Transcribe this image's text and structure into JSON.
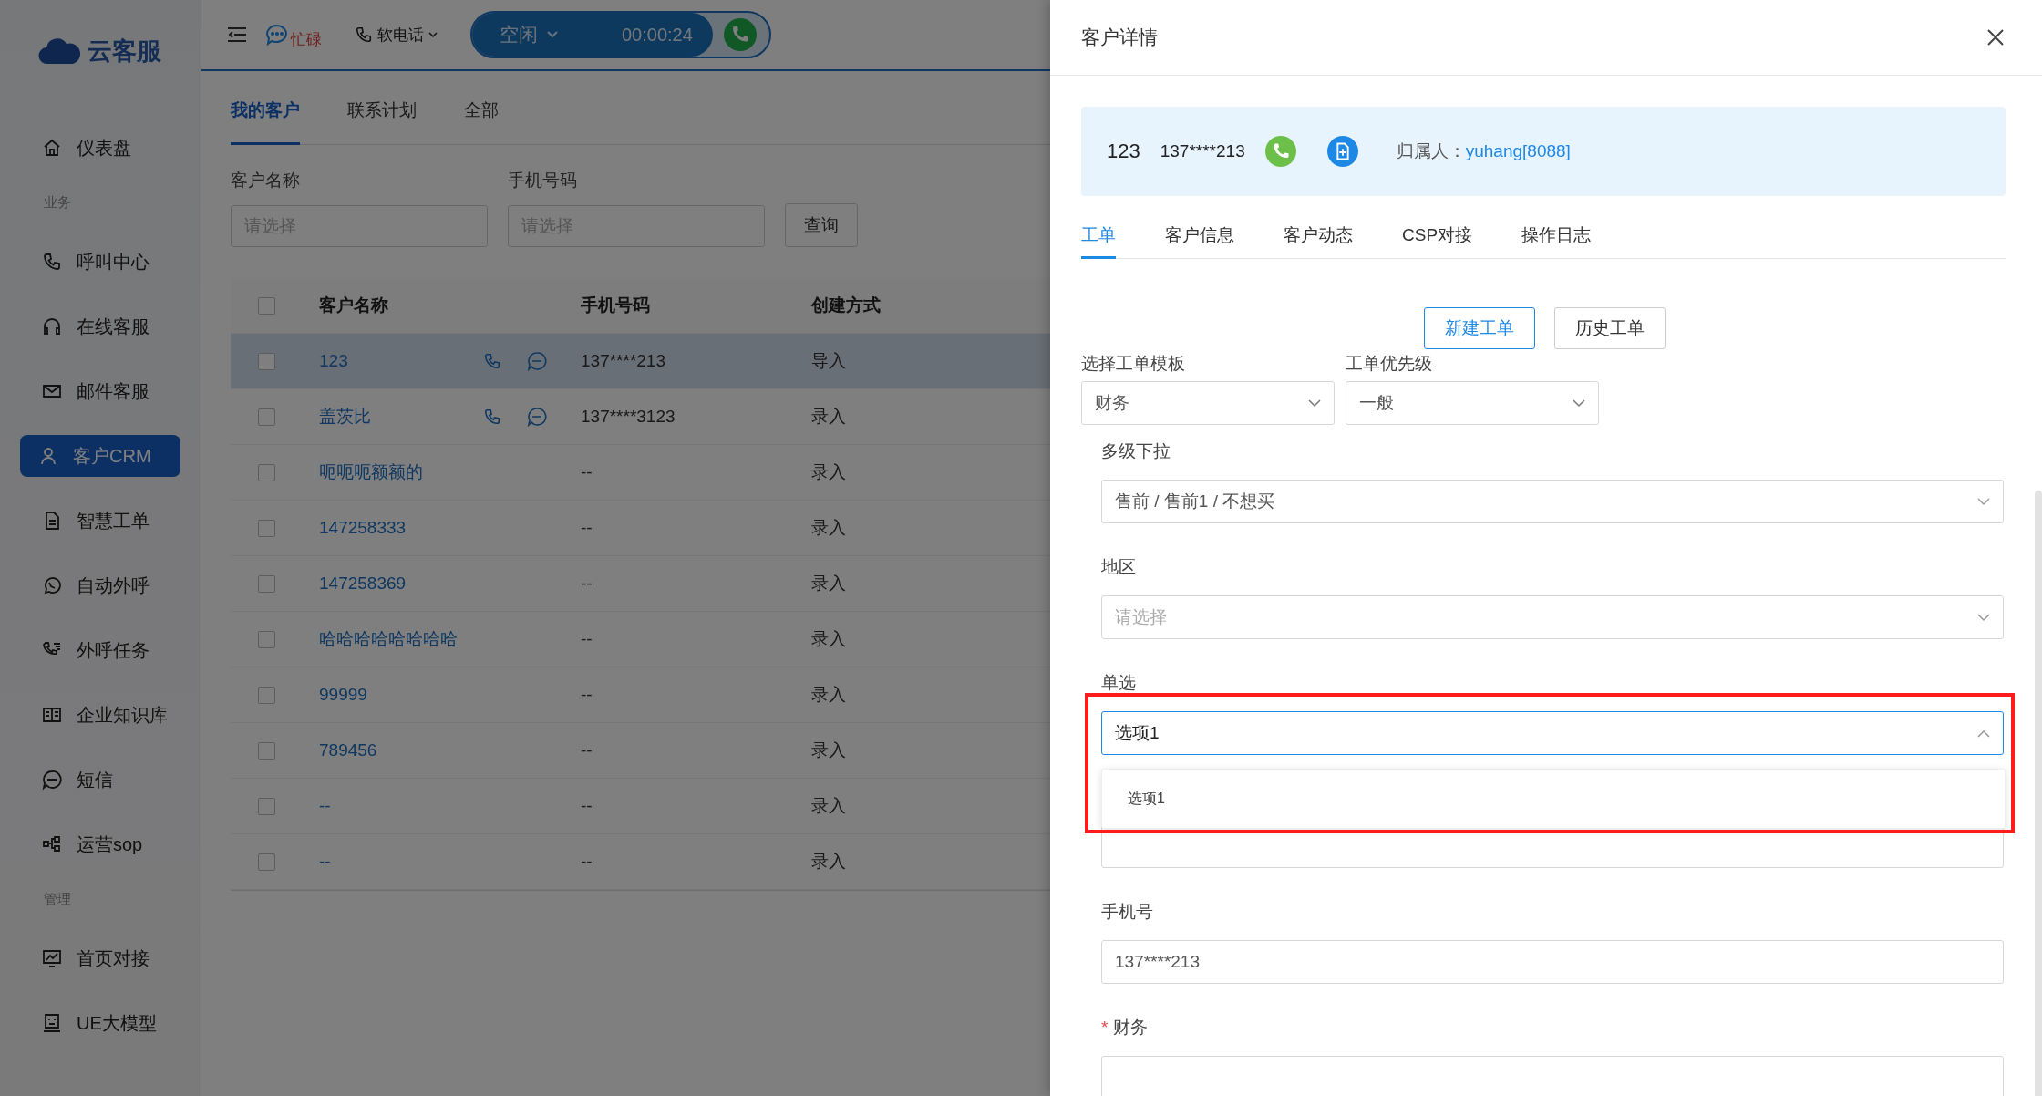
{
  "sidebar": {
    "logo": "云客服",
    "items": [
      {
        "kind": "item",
        "label": "仪表盘",
        "selected": false
      },
      {
        "kind": "section",
        "label": "业务"
      },
      {
        "kind": "item",
        "label": "呼叫中心",
        "selected": false
      },
      {
        "kind": "item",
        "label": "在线客服",
        "selected": false
      },
      {
        "kind": "item",
        "label": "邮件客服",
        "selected": false
      },
      {
        "kind": "item",
        "label": "客户CRM",
        "selected": true
      },
      {
        "kind": "item",
        "label": "智慧工单",
        "selected": false
      },
      {
        "kind": "item",
        "label": "自动外呼",
        "selected": false
      },
      {
        "kind": "item",
        "label": "外呼任务",
        "selected": false
      },
      {
        "kind": "item",
        "label": "企业知识库",
        "selected": false
      },
      {
        "kind": "item",
        "label": "短信",
        "selected": false
      },
      {
        "kind": "item",
        "label": "运营sop",
        "selected": false
      },
      {
        "kind": "section",
        "label": "管理"
      },
      {
        "kind": "item",
        "label": "首页对接",
        "selected": false
      },
      {
        "kind": "item",
        "label": "UE大模型",
        "selected": false
      }
    ]
  },
  "topbar": {
    "busy_status": "忙碌",
    "softphone": "软电话",
    "agent_state": "空闲",
    "timer": "00:00:24"
  },
  "tabs": [
    {
      "label": "我的客户",
      "selected": true
    },
    {
      "label": "联系计划",
      "selected": false
    },
    {
      "label": "全部",
      "selected": false
    }
  ],
  "filters": [
    {
      "label": "客户名称",
      "placeholder": "请选择"
    },
    {
      "label": "手机号码",
      "placeholder": "请选择"
    }
  ],
  "query_button": "查询",
  "table": {
    "select_all_checked": false,
    "columns": [
      "客户名称",
      "手机号码",
      "创建方式"
    ],
    "rows": [
      {
        "name": "123",
        "phone": "137****213",
        "method": "导入",
        "checked": false,
        "highlighted": true,
        "contact_actions": true
      },
      {
        "name": "盖茨比",
        "phone": "137****3123",
        "method": "录入",
        "checked": false,
        "highlighted": false,
        "contact_actions": true
      },
      {
        "name": "呃呃呃额额的",
        "phone": "--",
        "method": "录入",
        "checked": false,
        "highlighted": false,
        "contact_actions": false
      },
      {
        "name": "147258333",
        "phone": "--",
        "method": "录入",
        "checked": false,
        "highlighted": false,
        "contact_actions": false
      },
      {
        "name": "147258369",
        "phone": "--",
        "method": "录入",
        "checked": false,
        "highlighted": false,
        "contact_actions": false
      },
      {
        "name": "哈哈哈哈哈哈哈哈",
        "phone": "--",
        "method": "录入",
        "checked": false,
        "highlighted": false,
        "contact_actions": false
      },
      {
        "name": "99999",
        "phone": "--",
        "method": "录入",
        "checked": false,
        "highlighted": false,
        "contact_actions": false
      },
      {
        "name": "789456",
        "phone": "--",
        "method": "录入",
        "checked": false,
        "highlighted": false,
        "contact_actions": false
      },
      {
        "name": "--",
        "phone": "--",
        "method": "录入",
        "checked": false,
        "highlighted": false,
        "contact_actions": false
      },
      {
        "name": "--",
        "phone": "--",
        "method": "录入",
        "checked": false,
        "highlighted": false,
        "contact_actions": false
      }
    ]
  },
  "drawer": {
    "title": "客户详情",
    "card": {
      "name": "123",
      "phone": "137****213",
      "owner_label": "归属人：",
      "owner": "yuhang[8088]"
    },
    "tabs": [
      {
        "label": "工单",
        "selected": true
      },
      {
        "label": "客户信息",
        "selected": false
      },
      {
        "label": "客户动态",
        "selected": false
      },
      {
        "label": "CSP对接",
        "selected": false
      },
      {
        "label": "操作日志",
        "selected": false
      }
    ],
    "buttons": [
      {
        "label": "新建工单",
        "primary": true
      },
      {
        "label": "历史工单",
        "primary": false
      }
    ],
    "top_fields": [
      {
        "label": "选择工单模板",
        "value": "财务"
      },
      {
        "label": "工单优先级",
        "value": "一般"
      }
    ],
    "fields": [
      {
        "kind": "select",
        "label": "多级下拉",
        "value": "售前 / 售前1 / 不想买"
      },
      {
        "kind": "select",
        "label": "地区",
        "placeholder": "请选择"
      },
      {
        "kind": "select",
        "label": "单选",
        "value": "选项1",
        "expanded": true,
        "highlighted": true,
        "options": [
          "选项1"
        ]
      },
      {
        "kind": "text"
      },
      {
        "kind": "text",
        "label": "手机号",
        "value": "137****213"
      },
      {
        "kind": "text",
        "label": "财务",
        "required_mark": "*"
      }
    ]
  }
}
